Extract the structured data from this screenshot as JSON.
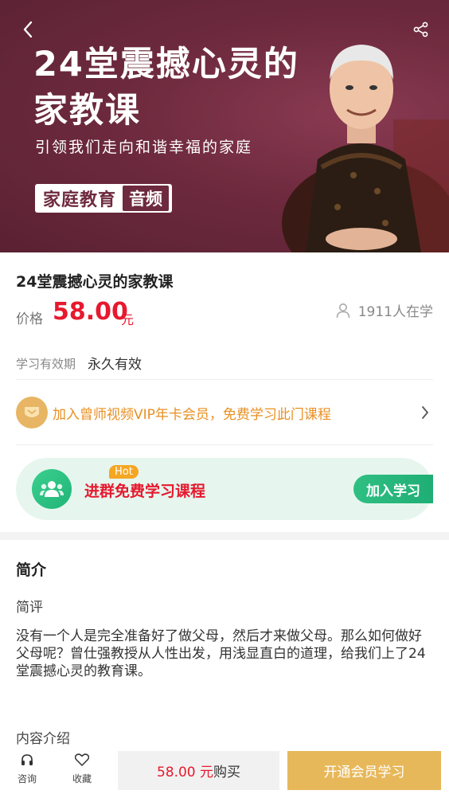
{
  "banner": {
    "title": "24堂震撼心灵的家教课",
    "subtitle": "引领我们走向和谐幸福的家庭",
    "tag_main": "家庭教育",
    "tag_sub": "音频",
    "background_color": "#6e2a3e"
  },
  "icons": {
    "back": "chevron-left-icon",
    "share": "share-icon",
    "learners": "person-icon",
    "vip": "vip-badge-icon",
    "vip_chevron": "chevron-right-icon",
    "group": "group-icon",
    "consult": "headphones-icon",
    "favorite": "heart-icon"
  },
  "course": {
    "title": "24堂震撼心灵的家教课",
    "price_label": "价格",
    "price": "58.00",
    "price_unit": "元",
    "learners": "1911人在学",
    "validity_label": "学习有效期",
    "validity_value": "永久有效"
  },
  "vip": {
    "text": "加入曾师视频VIP年卡会员，免费学习此门课程"
  },
  "group": {
    "hot": "Hot",
    "text": "进群免费学习课程",
    "button": "加入学习"
  },
  "intro": {
    "heading": "简介",
    "review_heading": "简评",
    "body": "没有一个人是完全准备好了做父母，然后才来做父母。那么如何做好父母呢？曾仕强教授从人性出发，用浅显直白的道理，给我们上了24堂震撼心灵的教育课。",
    "content_heading": "内容介绍"
  },
  "bottom": {
    "consult_label": "咨询",
    "favorite_label": "收藏",
    "buy_price": "58.00 元",
    "buy_label": "购买",
    "vip_button": "开通会员学习"
  },
  "colors": {
    "accent_red": "#e6192e",
    "vip_orange": "#e89023",
    "green": "#1fb578",
    "gold": "#e7b85a"
  }
}
